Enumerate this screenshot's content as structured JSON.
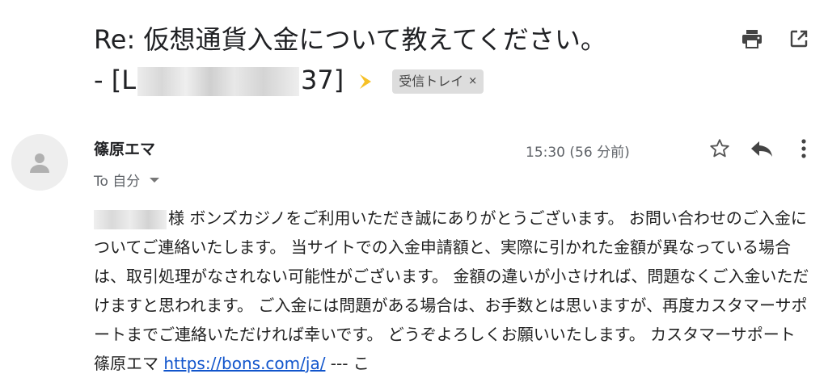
{
  "subject": {
    "line1": "Re: 仮想通貨入金について教えてください。",
    "line2_prefix": "- [L",
    "line2_suffix": "37]",
    "label": "受信トレイ",
    "label_remove": "×"
  },
  "toolbar": {
    "print_icon": "print-icon",
    "new_window_icon": "open-in-new-window-icon"
  },
  "message": {
    "sender": "篠原エマ",
    "to": "To 自分",
    "timestamp": "15:30 (56 分前)",
    "body_text": "様 ボンズカジノをご利用いただき誠にありがとうございます。 お問い合わせのご入金についてご連絡いたします。 当サイトでの入金申請額と、実際に引かれた金額が異なっている場合は、取引処理がなされない可能性がございます。 金額の違いが小さければ、問題なくご入金いただけますと思われます。 ご入金には問題がある場合は、お手数とは思いますが、再度カスタマーサポートまでご連絡いただければ幸いです。 どうぞよろしくお願いいたします。 カスタマーサポート 篠原エマ ",
    "link": "https://bons.com/ja/",
    "tail": " --- こ"
  },
  "colors": {
    "accent_link": "#1155cc",
    "important_marker": "#f6c026",
    "chip_bg": "#dddddd",
    "muted_text": "#5f6368"
  }
}
